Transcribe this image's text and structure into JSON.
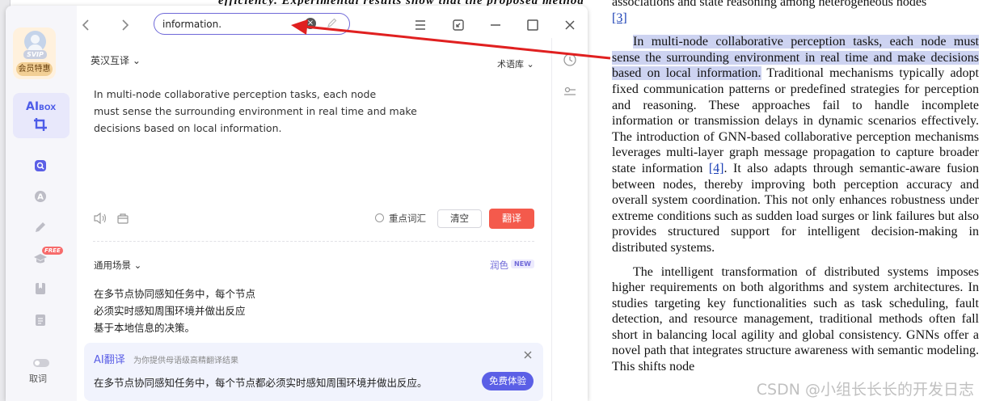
{
  "document": {
    "top_partial": "efficiency. Experimental results show that the proposed method",
    "line1": "associations and state reasoning among heterogeneous nodes",
    "cite3": "[3]",
    "para2_highlight": "In multi-node collaborative perception tasks, each node must sense the surrounding environment in real time and make decisions based on local information.",
    "para2_rest_a": " Traditional mechanisms typically adopt fixed communication patterns or predefined strategies for perception and reasoning. These approaches fail to handle incomplete information or transmission delays in dynamic scenarios effectively. The introduction of GNN-based collaborative perception mechanisms leverages multi-layer graph message propagation to capture broader state information ",
    "cite4": "[4]",
    "para2_rest_b": ". It also adapts through semantic-aware fusion between nodes, thereby improving both perception accuracy and overall system coordination. This not only enhances robustness under extreme conditions such as sudden load surges or link failures but also provides structured support for intelligent decision-making in distributed systems.",
    "para3": "The intelligent transformation of distributed systems imposes higher requirements on both algorithms and system architectures. In studies targeting key functionalities such as task scheduling, fault detection, and resource management, traditional methods often fall short in balancing local agility and global consistency. GNNs offer a novel path that integrates structure awareness with semantic modeling. This shifts node",
    "watermark": "CSDN @小组长长长的开发日志"
  },
  "colors": {
    "accent": "#5b5fe6",
    "translate_button": "#f45a4c",
    "highlight": "#cdd3f1",
    "vip": "#f2cf95"
  },
  "sidebar": {
    "vip_badge": "SVIP",
    "vip_label": "会员特惠",
    "aibox_title": "AI",
    "aibox_sub": "BOX",
    "free_badge": "FREE",
    "cancel_label": "取词",
    "icons": [
      "search-icon",
      "font-icon",
      "pen-icon",
      "graduation-cap-icon",
      "bookmark-icon",
      "notes-icon",
      "toggle-icon"
    ]
  },
  "toolbar": {
    "search_value": "information.",
    "back": "<",
    "forward": ">",
    "menu_icon": "hamburger-menu-icon",
    "shrink_icon": "shrink-window-icon",
    "maximize_icon": "maximize-icon",
    "close_icon": "close-icon"
  },
  "translate": {
    "lang_pair": "英汉互译",
    "term_library": "术语库",
    "source_text_lines": [
      "In multi-node collaborative perception tasks, each node",
      "must sense the surrounding environment in real time and make",
      "decisions based on local information."
    ],
    "key_vocab_label": "重点词汇",
    "clear_button": "清空",
    "translate_button": "翻译",
    "scene_select": "通用场景",
    "polish_label": "润色",
    "new_badge": "NEW",
    "target_text_lines": [
      "在多节点协同感知任务中，每个节点",
      "必须实时感知周围环境并做出反应",
      "基于本地信息的决策。"
    ]
  },
  "ai_card": {
    "title": "AI翻译",
    "subtitle": "为你提供母语级高精翻译结果",
    "result": "在多节点协同感知任务中，每个节点都必须实时感知周围环境并做出反应。",
    "trial_button": "免费体验"
  },
  "right_rail": {
    "icons": [
      "clock-history-icon",
      "settings-slider-icon"
    ]
  }
}
